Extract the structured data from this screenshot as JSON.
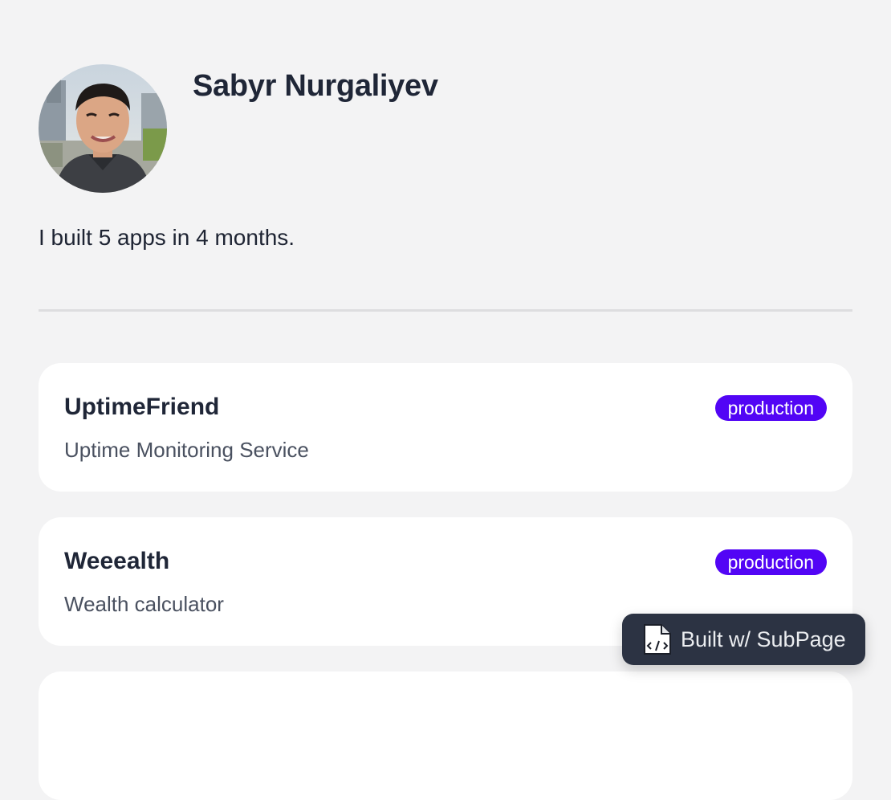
{
  "profile": {
    "name": "Sabyr Nurgaliyev",
    "bio": "I built 5 apps in 4 months."
  },
  "projects": [
    {
      "title": "UptimeFriend",
      "description": "Uptime Monitoring Service",
      "status": "production"
    },
    {
      "title": "Weeealth",
      "description": "Wealth calculator",
      "status": "production"
    }
  ],
  "footer": {
    "built_with_label": "Built w/ SubPage",
    "icon": "code-file-icon"
  },
  "colors": {
    "background": "#f3f3f4",
    "card": "#ffffff",
    "badge": "#5205f5",
    "text_primary": "#1f2637",
    "text_secondary": "#4a5160",
    "built_with_bg": "#2c3343"
  }
}
